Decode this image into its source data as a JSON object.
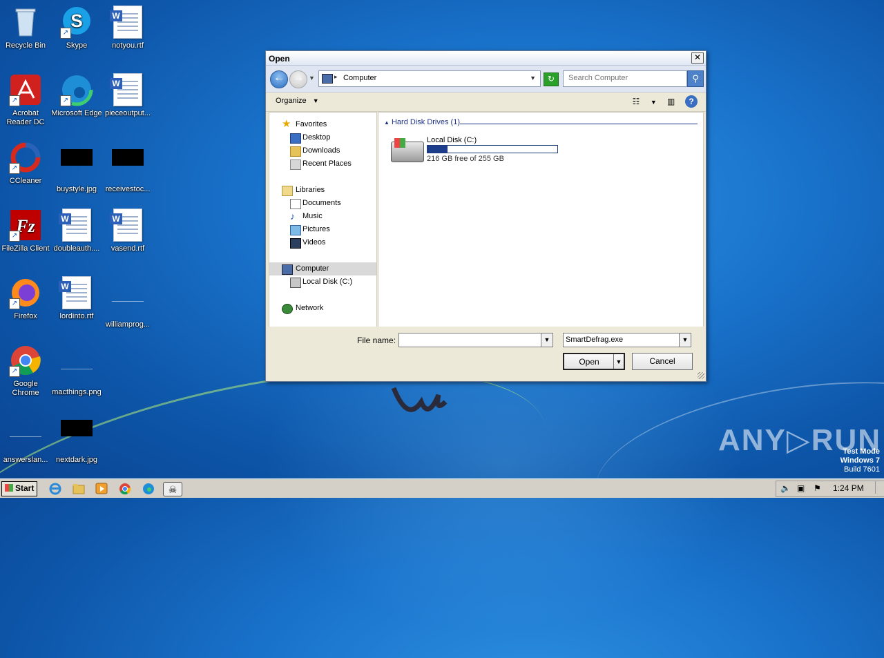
{
  "desktop": {
    "icons": [
      {
        "label": "Recycle Bin",
        "icon": "recycle-bin-icon"
      },
      {
        "label": "Skype",
        "icon": "skype-icon"
      },
      {
        "label": "notyou.rtf",
        "icon": "word-doc-icon"
      },
      {
        "label": "Acrobat Reader DC",
        "icon": "acrobat-icon"
      },
      {
        "label": "Microsoft Edge",
        "icon": "edge-icon"
      },
      {
        "label": "pieceoutput...",
        "icon": "word-doc-icon"
      },
      {
        "label": "CCleaner",
        "icon": "ccleaner-icon"
      },
      {
        "label": "buystyle.jpg",
        "icon": "image-thumbnail-icon"
      },
      {
        "label": "receivestoc...",
        "icon": "image-thumbnail-icon"
      },
      {
        "label": "FileZilla Client",
        "icon": "filezilla-icon"
      },
      {
        "label": "doubleauth....",
        "icon": "word-doc-icon"
      },
      {
        "label": "vasend.rtf",
        "icon": "word-doc-icon"
      },
      {
        "label": "Firefox",
        "icon": "firefox-icon"
      },
      {
        "label": "lordinto.rtf",
        "icon": "word-doc-icon"
      },
      {
        "label": "williamprog...",
        "icon": "blank-file-icon"
      },
      {
        "label": "Google Chrome",
        "icon": "chrome-icon"
      },
      {
        "label": "macthings.png",
        "icon": "blank-file-icon"
      },
      {
        "label": "answerslan...",
        "icon": "blank-file-icon"
      },
      {
        "label": "nextdark.jpg",
        "icon": "image-thumbnail-icon"
      }
    ]
  },
  "dialog": {
    "title": "Open",
    "close_symbol": "✕",
    "address": "Computer",
    "search_placeholder": "Search Computer",
    "organize_label": "Organize",
    "nav": {
      "favorites": "Favorites",
      "desktop": "Desktop",
      "downloads": "Downloads",
      "recent_places": "Recent Places",
      "libraries": "Libraries",
      "documents": "Documents",
      "music": "Music",
      "pictures": "Pictures",
      "videos": "Videos",
      "computer": "Computer",
      "local_disk": "Local Disk (C:)",
      "network": "Network"
    },
    "group_header": "Hard Disk Drives (1)",
    "drive": {
      "name": "Local Disk (C:)",
      "free_text": "216 GB free of 255 GB",
      "used_fraction": 0.153
    },
    "file_name_label": "File name:",
    "file_name_value": "",
    "file_type_value": "SmartDefrag.exe",
    "open_label": "Open",
    "cancel_label": "Cancel"
  },
  "watermark": {
    "brand": "ANY▷RUN",
    "test_mode": "Test Mode",
    "os": "Windows 7",
    "build": "Build 7601"
  },
  "taskbar": {
    "start_label": "Start",
    "clock": "1:24 PM",
    "pinned": [
      "internet-explorer-icon",
      "file-explorer-icon",
      "media-player-icon",
      "chrome-icon",
      "edge-icon",
      "smartdefrag-icon"
    ]
  }
}
